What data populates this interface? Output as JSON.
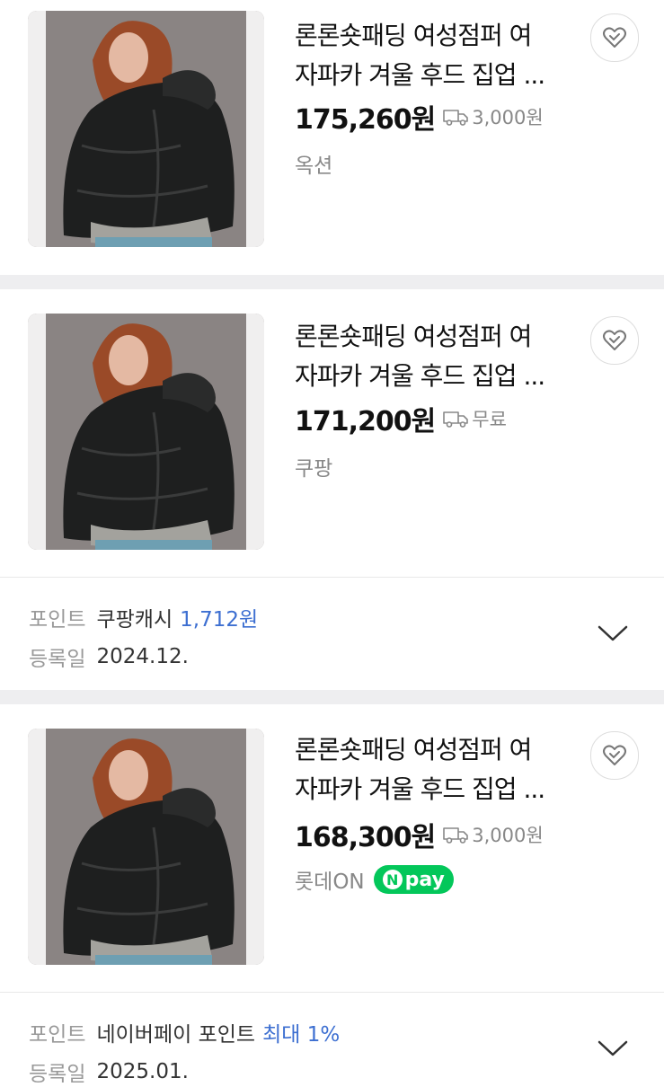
{
  "products": [
    {
      "title_line1": "론론숏패딩 여성점퍼 여",
      "title_line2": "자파카 겨울 후드 집업 ...",
      "price": "175,260원",
      "shipping": "3,000원",
      "mall": "옥션",
      "npay": false
    },
    {
      "title_line1": "론론숏패딩 여성점퍼 여",
      "title_line2": "자파카 겨울 후드 집업 ...",
      "price": "171,200원",
      "shipping": "무료",
      "mall": "쿠팡",
      "npay": false,
      "point_label": "포인트",
      "point_name": "쿠팡캐시",
      "point_value": "1,712원",
      "reg_label": "등록일",
      "reg_date": "2024.12."
    },
    {
      "title_line1": "론론숏패딩 여성점퍼 여",
      "title_line2": "자파카 겨울 후드 집업 ...",
      "price": "168,300원",
      "shipping": "3,000원",
      "mall": "롯데ON",
      "npay": true,
      "npay_label": "pay",
      "npay_n": "N",
      "point_label": "포인트",
      "point_name": "네이버페이 포인트",
      "point_value": "최대 1%",
      "reg_label": "등록일",
      "reg_date": "2025.01."
    }
  ],
  "icons": {
    "heart": "heart-icon",
    "truck": "truck-icon",
    "chevron": "chevron-down-icon"
  },
  "colors": {
    "accent_blue": "#3d6fd1",
    "npay_green": "#03c75a",
    "muted": "#888888"
  }
}
